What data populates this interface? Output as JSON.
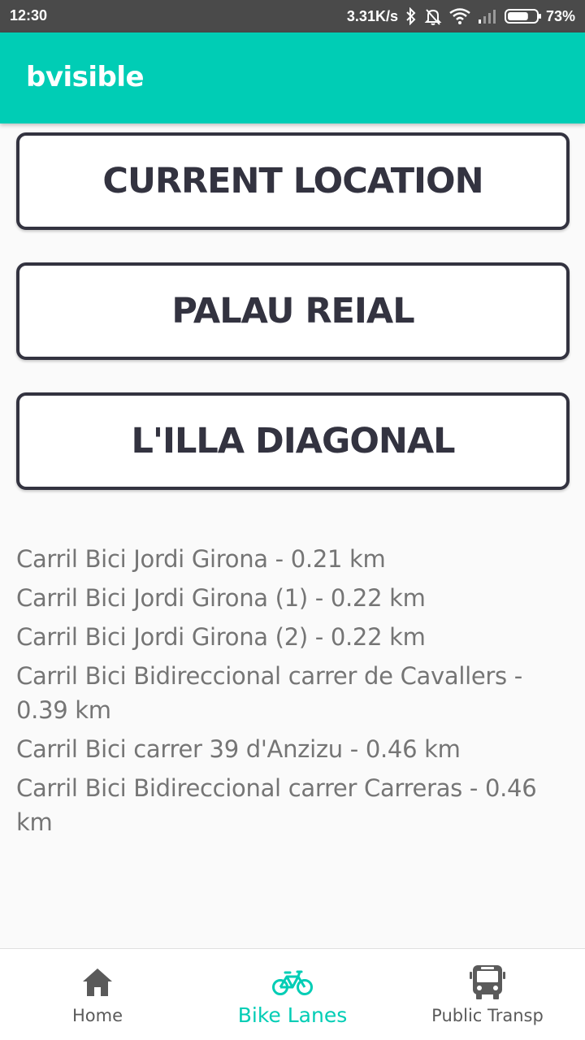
{
  "status_bar": {
    "time": "12:30",
    "network_speed": "3.31K/s",
    "battery_percent": "73%",
    "battery_level": 0.73,
    "icons": [
      "bluetooth-icon",
      "bell-off-icon",
      "wifi-icon",
      "signal-icon",
      "battery-icon"
    ]
  },
  "app_bar": {
    "title": "bvisible",
    "color": "#00cdb5"
  },
  "locations": [
    {
      "label": "CURRENT LOCATION"
    },
    {
      "label": "PALAU REIAL"
    },
    {
      "label": "L'ILLA DIAGONAL"
    }
  ],
  "bike_lanes": [
    {
      "text": "Carril Bici Jordi Girona - 0.21 km"
    },
    {
      "text": "Carril Bici Jordi Girona (1) - 0.22 km"
    },
    {
      "text": "Carril Bici Jordi Girona (2) - 0.22 km"
    },
    {
      "text": "Carril Bici Bidireccional carrer de Cavallers - 0.39 km"
    },
    {
      "text": "Carril Bici carrer 39 d'Anzizu - 0.46 km"
    },
    {
      "text": "Carril Bici Bidireccional carrer Carreras - 0.46 km"
    }
  ],
  "bottom_nav": {
    "items": [
      {
        "label": "Home",
        "icon": "home-icon",
        "active": false
      },
      {
        "label": "Bike Lanes",
        "icon": "bicycle-icon",
        "active": true
      },
      {
        "label": "Public Transp",
        "icon": "bus-icon",
        "active": false
      }
    ],
    "active_color": "#00cdb5",
    "inactive_color": "#5a5a5a"
  }
}
